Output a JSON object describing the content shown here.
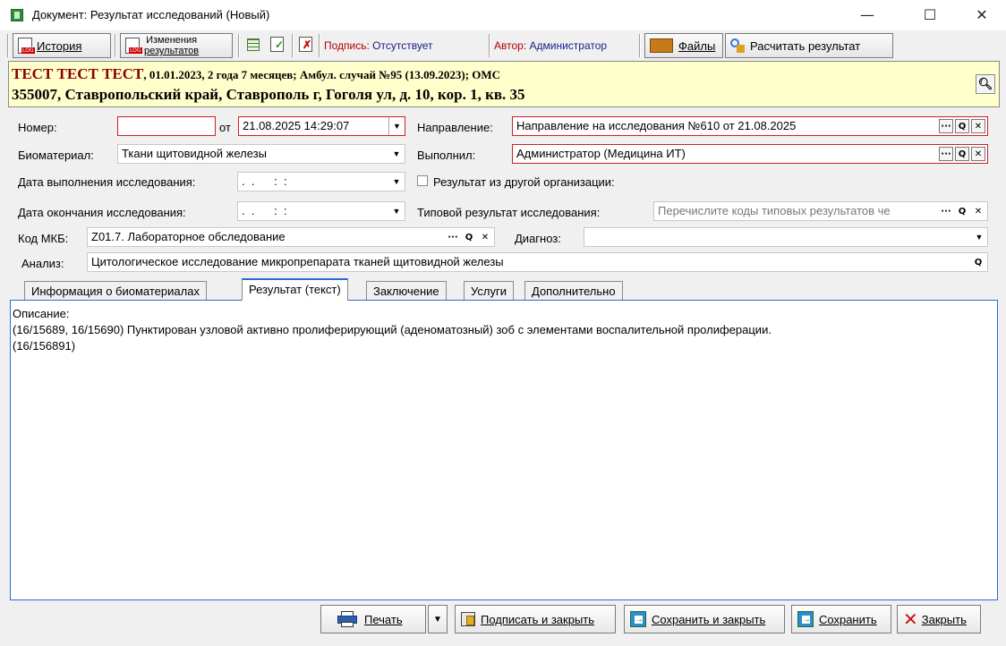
{
  "window": {
    "title": "Документ: Результат исследований (Новый)",
    "minimize": "—",
    "maximize": "☐",
    "close": "✕"
  },
  "toolbar": {
    "history": "История",
    "changes_line1": "Изменения",
    "changes_line2": "результатов",
    "signature_label": "Подпись:",
    "signature_value": "Отсутствует",
    "author_label": "Автор:",
    "author_value": "Администратор",
    "files": "Файлы",
    "calculate": "Расчитать результат"
  },
  "patient": {
    "name": "ТЕСТ ТЕСТ ТЕСТ",
    "info": ", 01.01.2023, 2 года 7 месяцев; Амбул. случай №95 (13.09.2023); ОМС",
    "address": "355007, Ставропольский край, Ставрополь г, Гоголя ул, д. 10, кор. 1, кв. 35"
  },
  "form": {
    "number_label": "Номер:",
    "number_value": "",
    "from_label": "от",
    "date_value": "21.08.2025 14:29:07",
    "direction_label": "Направление:",
    "direction_value": "Направление на исследования №610 от 21.08.2025",
    "biomaterial_label": "Биоматериал:",
    "biomaterial_value": "Ткани щитовидной железы",
    "performed_label": "Выполнил:",
    "performed_value": "Администратор (Медицина ИТ)",
    "exec_date_label": "Дата выполнения исследования:",
    "exec_date_value": ".  .      :  :",
    "other_org_label": "Результат из другой организации:",
    "end_date_label": "Дата окончания исследования:",
    "end_date_value": ".  .      :  :",
    "typical_label": "Типовой результат исследования:",
    "typical_placeholder": "Перечислите коды типовых результатов че",
    "mkb_label": "Код МКБ:",
    "mkb_value": "Z01.7. Лабораторное обследование",
    "diagnosis_label": "Диагноз:",
    "diagnosis_value": "",
    "analysis_label": "Анализ:",
    "analysis_value": "Цитологическое исследование микропрепарата тканей щитовидной железы"
  },
  "tabs": [
    "Информация о биоматериалах",
    "Результат (текст)",
    "Заключение",
    "Услуги",
    "Дополнительно"
  ],
  "content": {
    "text": "Описание:\n(16/15689, 16/15690) Пунктирован узловой активно пролиферирующий (аденоматозный) зоб с элементами воспалительной пролиферации.\n(16/156891)"
  },
  "buttons": {
    "print": "Печать",
    "sign_close": "Подписать и закрыть",
    "save_close": "Сохранить и закрыть",
    "save": "Сохранить",
    "close": "Закрыть"
  },
  "icons": {
    "search": "search-icon",
    "ellipsis": "ellipsis-icon",
    "clear": "clear-icon",
    "dropdown": "chevron-down-icon"
  }
}
